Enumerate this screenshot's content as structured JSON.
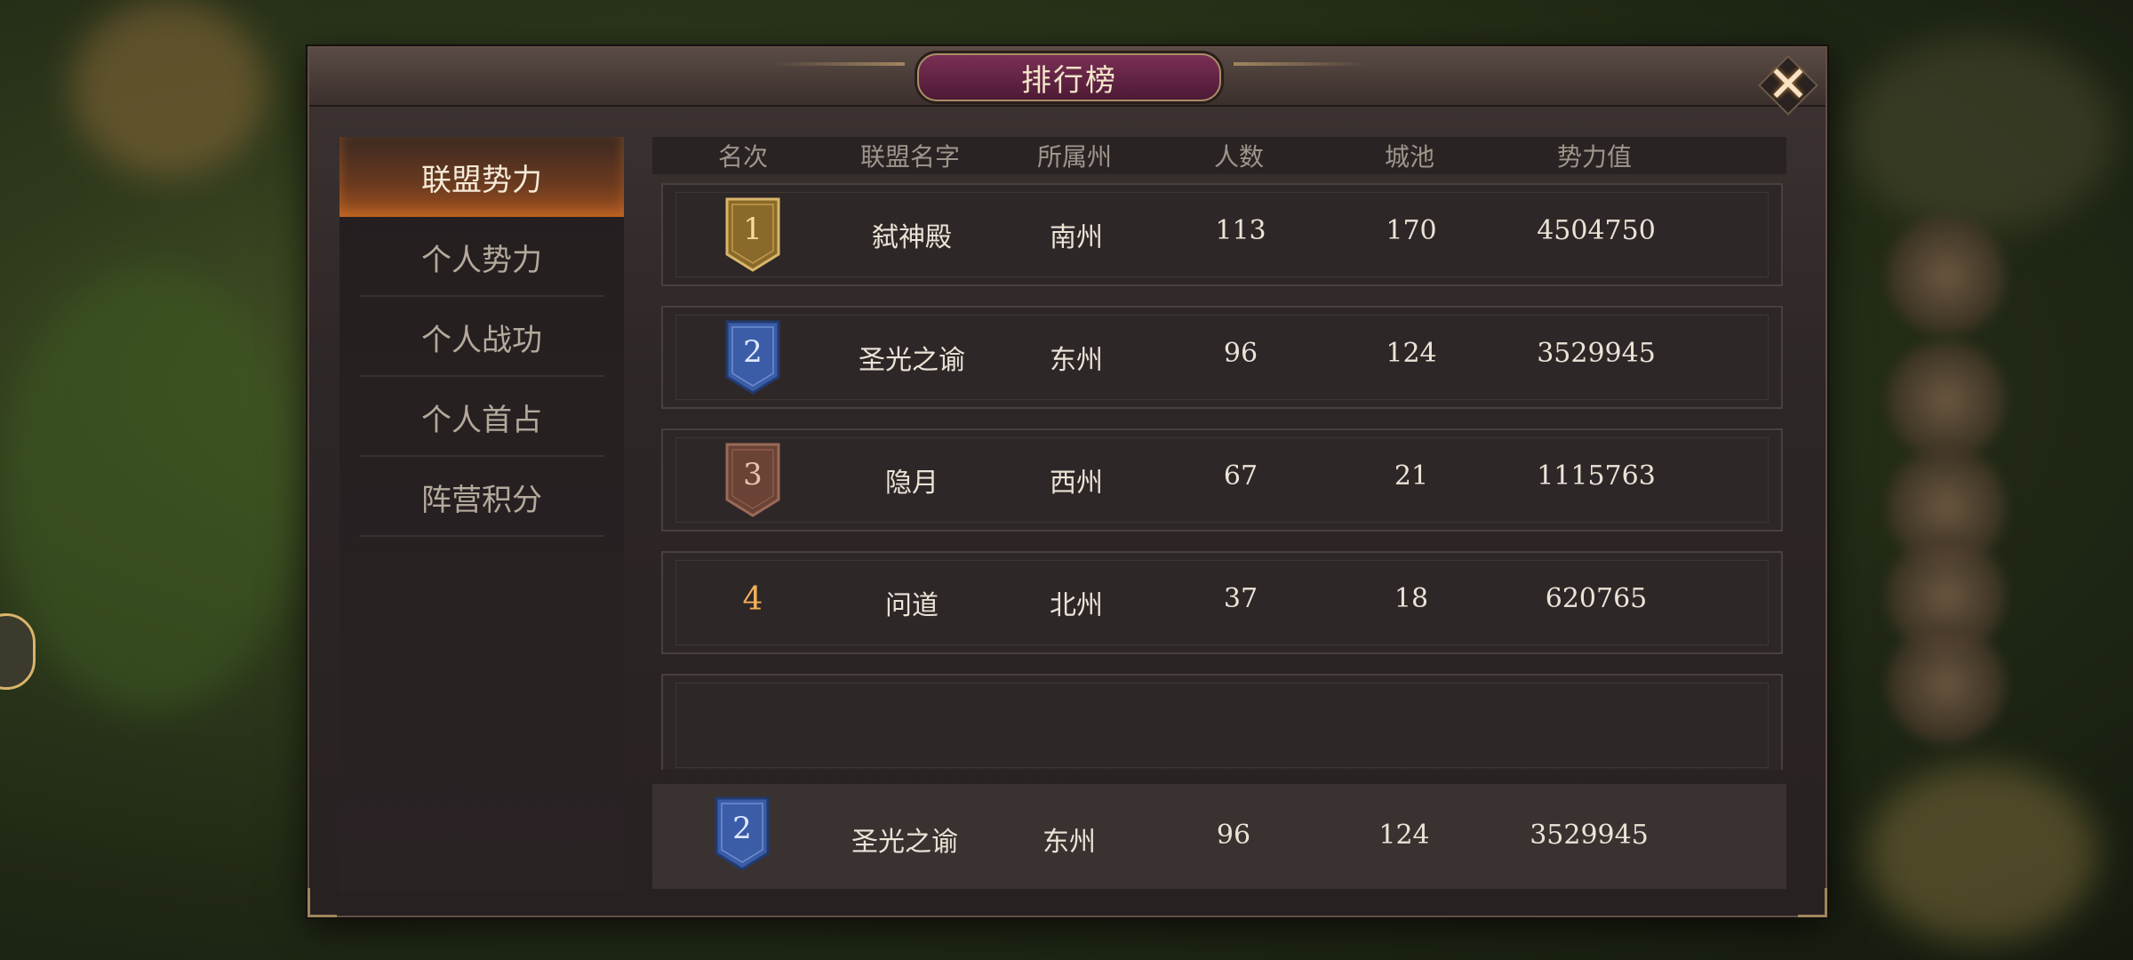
{
  "window": {
    "title": "排行榜"
  },
  "sidebar": {
    "items": [
      {
        "label": "联盟势力",
        "active": true
      },
      {
        "label": "个人势力",
        "active": false
      },
      {
        "label": "个人战功",
        "active": false
      },
      {
        "label": "个人首占",
        "active": false
      },
      {
        "label": "阵营积分",
        "active": false
      }
    ]
  },
  "table": {
    "headers": [
      "名次",
      "联盟名字",
      "所属州",
      "人数",
      "城池",
      "势力值"
    ],
    "rows": [
      {
        "rank": "1",
        "name": "弑神殿",
        "state": "南州",
        "members": "113",
        "cities": "170",
        "power": "4504750",
        "badge": "gold"
      },
      {
        "rank": "2",
        "name": "圣光之谕",
        "state": "东州",
        "members": "96",
        "cities": "124",
        "power": "3529945",
        "badge": "blue"
      },
      {
        "rank": "3",
        "name": "隐月",
        "state": "西州",
        "members": "67",
        "cities": "21",
        "power": "1115763",
        "badge": "bronze"
      },
      {
        "rank": "4",
        "name": "问道",
        "state": "北州",
        "members": "37",
        "cities": "18",
        "power": "620765",
        "badge": "none"
      }
    ]
  },
  "my_alliance": {
    "rank": "2",
    "name": "圣光之谕",
    "state": "东州",
    "members": "96",
    "cities": "124",
    "power": "3529945",
    "badge": "blue"
  },
  "colors": {
    "gold_badge": "#8a6a2a",
    "blue_badge": "#3b5da8",
    "bronze_badge": "#6b4236",
    "active_tab": "#a2531f",
    "rank4_text": "#f0b157"
  },
  "icons": {
    "close": "close-icon",
    "badge": "rank-ribbon-icon"
  }
}
